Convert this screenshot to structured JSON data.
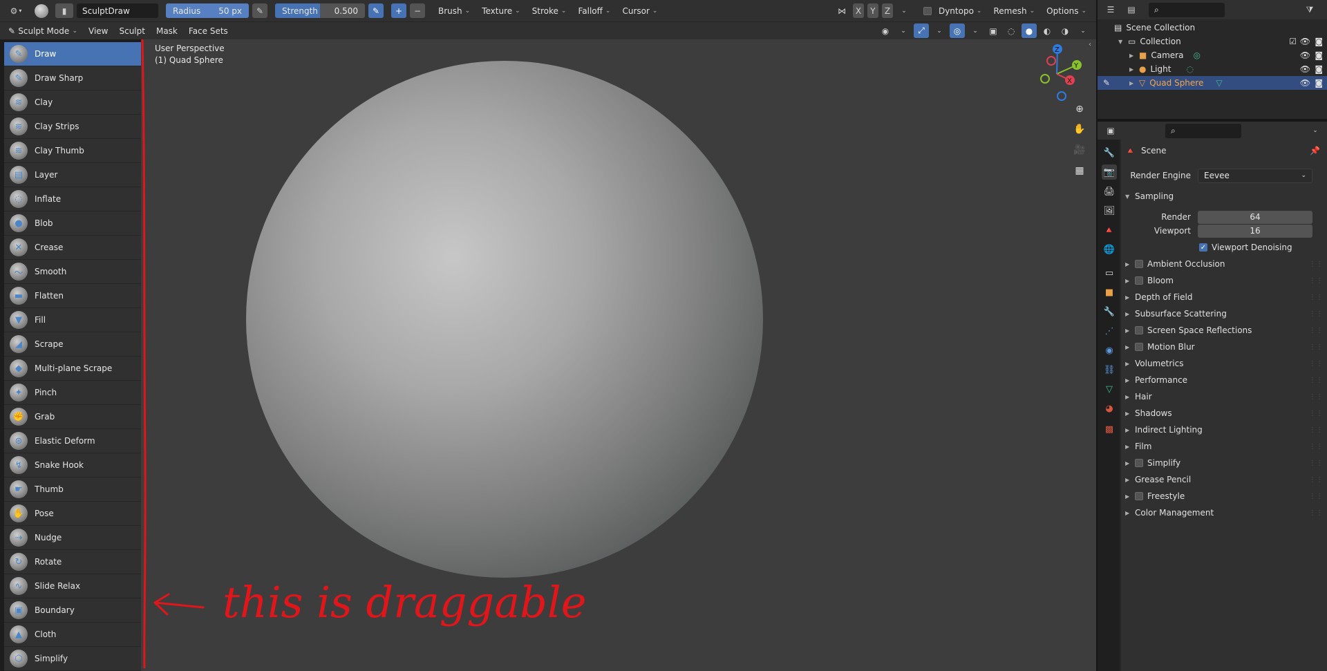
{
  "topbar": {
    "brush_name": "SculptDraw",
    "radius_label": "Radius",
    "radius_value": "50 px",
    "strength_label": "Strength",
    "strength_value": "0.500",
    "menus": [
      "Brush",
      "Texture",
      "Stroke",
      "Falloff",
      "Cursor"
    ],
    "axes": [
      "X",
      "Y",
      "Z"
    ],
    "dyntopo": "Dyntopo",
    "remesh": "Remesh",
    "options": "Options"
  },
  "modebar": {
    "mode": "Sculpt Mode",
    "menus": [
      "View",
      "Sculpt",
      "Mask",
      "Face Sets"
    ]
  },
  "tools": [
    {
      "label": "Draw",
      "active": true
    },
    {
      "label": "Draw Sharp"
    },
    {
      "label": "Clay"
    },
    {
      "label": "Clay Strips"
    },
    {
      "label": "Clay Thumb"
    },
    {
      "label": "Layer"
    },
    {
      "label": "Inflate"
    },
    {
      "label": "Blob"
    },
    {
      "label": "Crease"
    },
    {
      "label": "Smooth"
    },
    {
      "label": "Flatten"
    },
    {
      "label": "Fill"
    },
    {
      "label": "Scrape"
    },
    {
      "label": "Multi-plane Scrape"
    },
    {
      "label": "Pinch"
    },
    {
      "label": "Grab"
    },
    {
      "label": "Elastic Deform"
    },
    {
      "label": "Snake Hook"
    },
    {
      "label": "Thumb"
    },
    {
      "label": "Pose"
    },
    {
      "label": "Nudge"
    },
    {
      "label": "Rotate"
    },
    {
      "label": "Slide Relax"
    },
    {
      "label": "Boundary"
    },
    {
      "label": "Cloth"
    },
    {
      "label": "Simplify"
    }
  ],
  "viewport": {
    "perspective": "User Perspective",
    "object": "(1) Quad Sphere",
    "annotation": "this is draggable",
    "gizmo": {
      "x": "X",
      "y": "Y",
      "z": "Z"
    }
  },
  "outliner": {
    "root": "Scene Collection",
    "collection": "Collection",
    "items": [
      "Camera",
      "Light",
      "Quad Sphere"
    ]
  },
  "properties": {
    "scene": "Scene",
    "render_engine_label": "Render Engine",
    "render_engine_value": "Eevee",
    "sampling": "Sampling",
    "render_label": "Render",
    "render_value": "64",
    "viewport_label": "Viewport",
    "viewport_value": "16",
    "denoise_label": "Viewport Denoising",
    "panels": [
      {
        "label": "Ambient Occlusion",
        "check": true
      },
      {
        "label": "Bloom",
        "check": true
      },
      {
        "label": "Depth of Field",
        "check": false
      },
      {
        "label": "Subsurface Scattering",
        "check": false
      },
      {
        "label": "Screen Space Reflections",
        "check": true
      },
      {
        "label": "Motion Blur",
        "check": true
      },
      {
        "label": "Volumetrics",
        "check": false
      },
      {
        "label": "Performance",
        "check": false
      },
      {
        "label": "Hair",
        "check": false
      },
      {
        "label": "Shadows",
        "check": false
      },
      {
        "label": "Indirect Lighting",
        "check": false
      },
      {
        "label": "Film",
        "check": false
      },
      {
        "label": "Simplify",
        "check": true
      },
      {
        "label": "Grease Pencil",
        "check": false
      },
      {
        "label": "Freestyle",
        "check": true
      },
      {
        "label": "Color Management",
        "check": false
      }
    ]
  },
  "colors": {
    "accent": "#4772b3",
    "annotation": "#e0161b",
    "selected_row": "#334d80"
  }
}
